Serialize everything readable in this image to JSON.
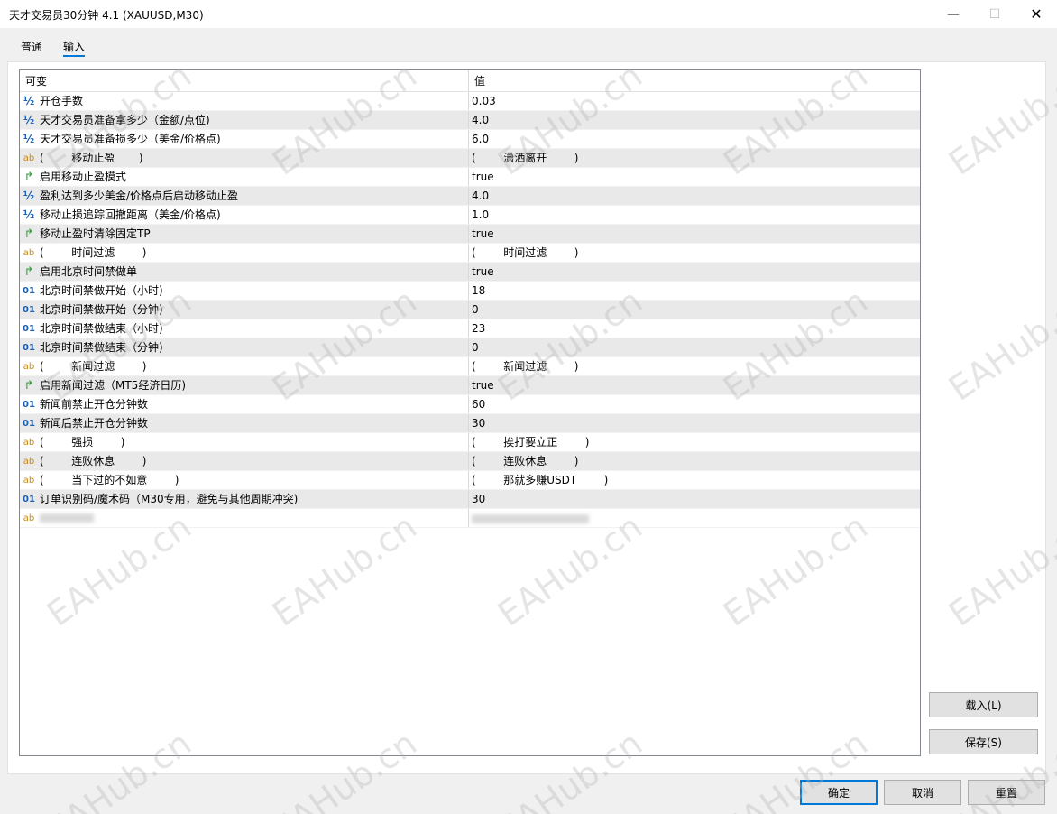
{
  "window": {
    "title": "天才交易员30分钟 4.1 (XAUUSD,M30)",
    "minimize_glyph": "—",
    "maximize_glyph": "☐",
    "close_glyph": "✕"
  },
  "tabs": [
    {
      "label": "普通",
      "active": false
    },
    {
      "label": "输入",
      "active": true
    }
  ],
  "grid": {
    "headers": [
      "可变",
      "值"
    ],
    "rows": [
      {
        "icon": "½",
        "type": "half",
        "name": "开仓手数",
        "value": "0.03"
      },
      {
        "icon": "½",
        "type": "half",
        "name": "天才交易员准备拿多少（金额/点位)",
        "value": "4.0"
      },
      {
        "icon": "½",
        "type": "half",
        "name": "天才交易员准备损多少（美金/价格点)",
        "value": "6.0"
      },
      {
        "icon": "ab",
        "type": "ab",
        "name": "(        移动止盈       )",
        "value": "(        潇洒离开        )"
      },
      {
        "icon": "↱",
        "type": "bool",
        "name": "启用移动止盈模式",
        "value": "true"
      },
      {
        "icon": "½",
        "type": "half",
        "name": "盈利达到多少美金/价格点后启动移动止盈",
        "value": "4.0"
      },
      {
        "icon": "½",
        "type": "half",
        "name": "移动止损追踪回撤距离（美金/价格点)",
        "value": "1.0"
      },
      {
        "icon": "↱",
        "type": "bool",
        "name": "移动止盈时清除固定TP",
        "value": "true"
      },
      {
        "icon": "ab",
        "type": "ab",
        "name": "(        时间过滤        )",
        "value": "(        时间过滤        )"
      },
      {
        "icon": "↱",
        "type": "bool",
        "name": "启用北京时间禁做单",
        "value": "true"
      },
      {
        "icon": "01",
        "type": "num",
        "name": "北京时间禁做开始（小时)",
        "value": "18"
      },
      {
        "icon": "01",
        "type": "num",
        "name": "北京时间禁做开始（分钟)",
        "value": "0"
      },
      {
        "icon": "01",
        "type": "num",
        "name": "北京时间禁做结束（小时)",
        "value": "23"
      },
      {
        "icon": "01",
        "type": "num",
        "name": "北京时间禁做结束（分钟)",
        "value": "0"
      },
      {
        "icon": "ab",
        "type": "ab",
        "name": "(        新闻过滤        )",
        "value": "(        新闻过滤        )"
      },
      {
        "icon": "↱",
        "type": "bool",
        "name": "启用新闻过滤（MT5经济日历)",
        "value": "true"
      },
      {
        "icon": "01",
        "type": "num",
        "name": "新闻前禁止开仓分钟数",
        "value": "60"
      },
      {
        "icon": "01",
        "type": "num",
        "name": "新闻后禁止开仓分钟数",
        "value": "30"
      },
      {
        "icon": "ab",
        "type": "ab",
        "name": "(        强损        )",
        "value": "(        挨打要立正        )"
      },
      {
        "icon": "ab",
        "type": "ab",
        "name": "(        连败休息        )",
        "value": "(        连败休息        )"
      },
      {
        "icon": "ab",
        "type": "ab",
        "name": "(        当下过的不如意        )",
        "value": "(        那就多赚USDT        )"
      },
      {
        "icon": "01",
        "type": "num",
        "name": "订单识别码/魔术码（M30专用，避免与其他周期冲突)",
        "value": "30"
      },
      {
        "icon": "ab",
        "type": "ab",
        "name": "",
        "value": "",
        "blurred": true
      }
    ]
  },
  "buttons": {
    "load": "载入(L)",
    "save": "保存(S)",
    "ok": "确定",
    "cancel": "取消",
    "reset": "重置"
  },
  "watermark": "EAHub.cn"
}
